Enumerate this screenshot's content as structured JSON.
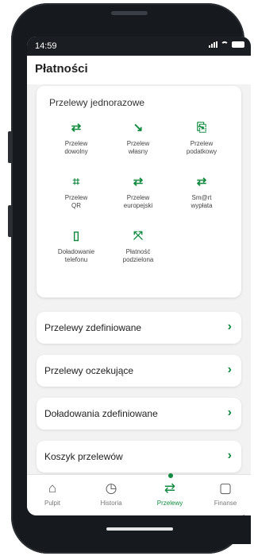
{
  "status_bar": {
    "time": "14:59"
  },
  "header": {
    "title": "Płatności"
  },
  "one_time_transfers": {
    "title": "Przelewy jednorazowe",
    "tiles": [
      {
        "label": "Przelew\ndowolny",
        "icon": "⇄"
      },
      {
        "label": "Przelew\nwłasny",
        "icon": "↘"
      },
      {
        "label": "Przelew\npodatkowy",
        "icon": "⎘"
      },
      {
        "label": "Przelew\nQR",
        "icon": "⌗"
      },
      {
        "label": "Przelew\neuropejski",
        "icon": "⇄"
      },
      {
        "label": "Sm@rt\nwypłata",
        "icon": "⇄"
      },
      {
        "label": "Doładowanie\ntelefonu",
        "icon": "▯"
      },
      {
        "label": "Płatność\npodzielona",
        "icon": "⤧"
      }
    ]
  },
  "menu_rows": [
    {
      "label": "Przelewy zdefiniowane"
    },
    {
      "label": "Przelewy oczekujące"
    },
    {
      "label": "Doładowania zdefiniowane"
    },
    {
      "label": "Koszyk przelewów"
    }
  ],
  "chevron": "›",
  "tab_bar": {
    "tabs": [
      {
        "label": "Pulpit",
        "icon": "⌂"
      },
      {
        "label": "Historia",
        "icon": "◷"
      },
      {
        "label": "Przelewy",
        "icon": "⇄"
      },
      {
        "label": "Finanse",
        "icon": "▢"
      }
    ],
    "active": "Przelewy"
  },
  "colors": {
    "accent": "#0f8a3f",
    "background": "#f2f2f2"
  }
}
